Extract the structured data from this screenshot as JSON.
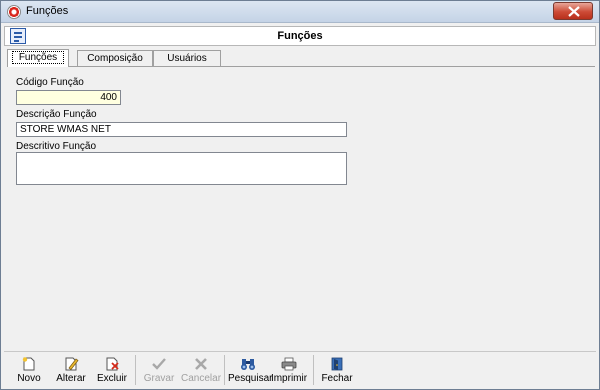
{
  "window": {
    "title": "Funções"
  },
  "header": {
    "title": "Funções"
  },
  "tabs": [
    {
      "label": "Funções"
    },
    {
      "label": "Composição"
    },
    {
      "label": "Usuários"
    }
  ],
  "form": {
    "codigo": {
      "label": "Código Função",
      "value": "400"
    },
    "descricao": {
      "label": "Descrição Função",
      "value": "STORE WMAS NET"
    },
    "descritivo": {
      "label": "Descritivo Função",
      "value": ""
    }
  },
  "toolbar": {
    "novo": "Novo",
    "alterar": "Alterar",
    "excluir": "Excluir",
    "gravar": "Gravar",
    "cancelar": "Cancelar",
    "pesquisar": "Pesquisar",
    "imprimir": "Imprimir",
    "fechar": "Fechar"
  },
  "icons": {
    "app": "record-icon",
    "close": "close-icon",
    "form": "form-icon",
    "novo": "new-document-icon",
    "alterar": "edit-pencil-icon",
    "excluir": "delete-document-icon",
    "gravar": "checkmark-icon",
    "cancelar": "cancel-x-icon",
    "pesquisar": "binoculars-icon",
    "imprimir": "printer-icon",
    "fechar": "exit-door-icon"
  }
}
